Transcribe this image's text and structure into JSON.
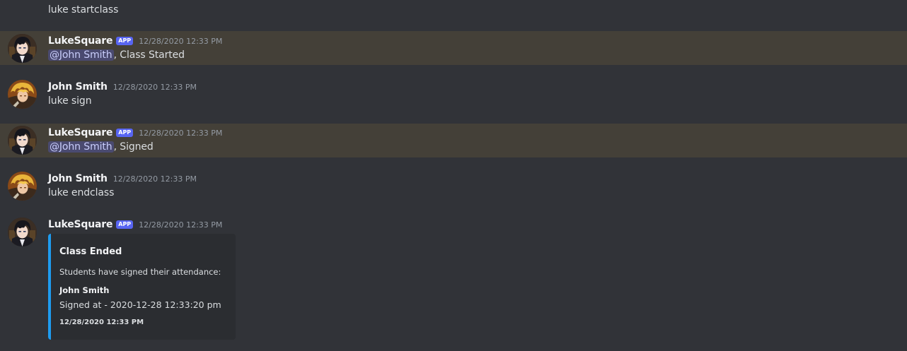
{
  "messages": [
    {
      "content": "luke startclass"
    },
    {
      "author": "LukeSquare",
      "badge": "APP",
      "timestamp": "12/28/2020 12:33 PM",
      "mention": "@John Smith",
      "content": ", Class Started"
    },
    {
      "author": "John Smith",
      "timestamp": "12/28/2020 12:33 PM",
      "content": "luke sign"
    },
    {
      "author": "LukeSquare",
      "badge": "APP",
      "timestamp": "12/28/2020 12:33 PM",
      "mention": "@John Smith",
      "content": ", Signed"
    },
    {
      "author": "John Smith",
      "timestamp": "12/28/2020 12:33 PM",
      "content": "luke endclass"
    },
    {
      "author": "LukeSquare",
      "badge": "APP",
      "timestamp": "12/28/2020 12:33 PM",
      "embed": {
        "title": "Class Ended",
        "description": "Students have signed their attendance:",
        "field_name": "John Smith",
        "field_value": "Signed at - 2020-12-28 12:33:20 pm",
        "footer": "12/28/2020 12:33 PM",
        "accent_color": "#1e9cf0"
      }
    }
  ],
  "colors": {
    "background": "#313338",
    "highlight": "#444038",
    "app_badge": "#5865f2",
    "mention_bg": "#3e4270"
  },
  "icons": {
    "bot_avatar": "bot-avatar-icon",
    "user_avatar": "user-avatar-icon"
  }
}
